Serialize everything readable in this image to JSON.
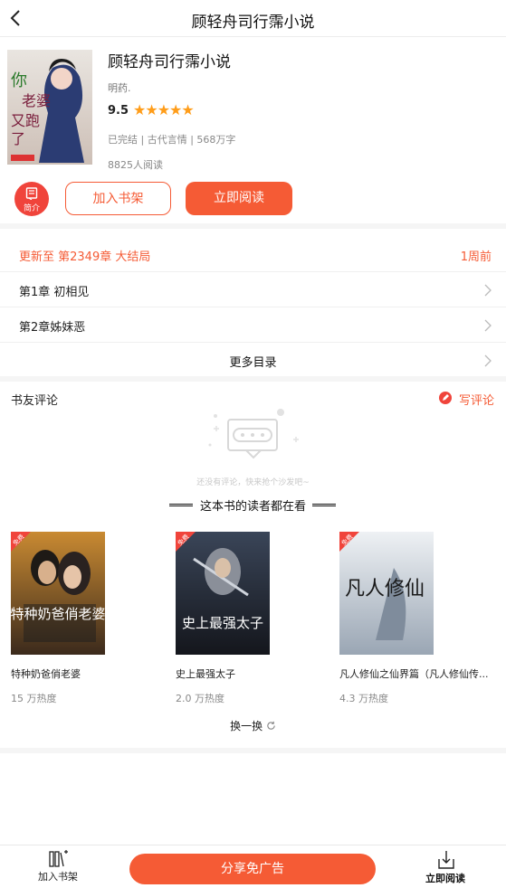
{
  "header": {
    "title": "顾轻舟司行霈小说"
  },
  "book": {
    "title": "顾轻舟司行霈小说",
    "author": "明药.",
    "score": "9.5",
    "stars": "★★★★★",
    "meta": "已完结 | 古代言情 | 568万字",
    "reads": "8825人阅读",
    "cover_text": "你老婆又跑了"
  },
  "actions": {
    "intro_label": "简介",
    "add_shelf": "加入书架",
    "read_now": "立即阅读"
  },
  "chapters": {
    "update_text": "更新至 第2349章 大结局",
    "update_time": "1周前",
    "items": [
      "第1章 初相见",
      "第2章姊妹恶"
    ],
    "more": "更多目录"
  },
  "comments": {
    "title": "书友评论",
    "write": "写评论",
    "empty": "还没有评论，快来抢个沙发吧~"
  },
  "recommend": {
    "title": "这本书的读者都在看",
    "badge": "免费",
    "items": [
      {
        "title": "特种奶爸俏老婆",
        "heat": "15 万热度",
        "cover_text": "特种奶爸俏老婆"
      },
      {
        "title": "史上最强太子",
        "heat": "2.0 万热度",
        "cover_text": "史上最强太子"
      },
      {
        "title": "凡人修仙之仙界篇（凡人修仙传...",
        "heat": "4.3 万热度",
        "cover_text": "凡人修仙"
      }
    ],
    "refresh": "换一换"
  },
  "bottom": {
    "add_shelf": "加入书架",
    "share": "分享免广告",
    "read_now": "立即阅读"
  },
  "colors": {
    "accent": "#f55b35",
    "red": "#f0443b",
    "star": "#ff9d1a"
  }
}
